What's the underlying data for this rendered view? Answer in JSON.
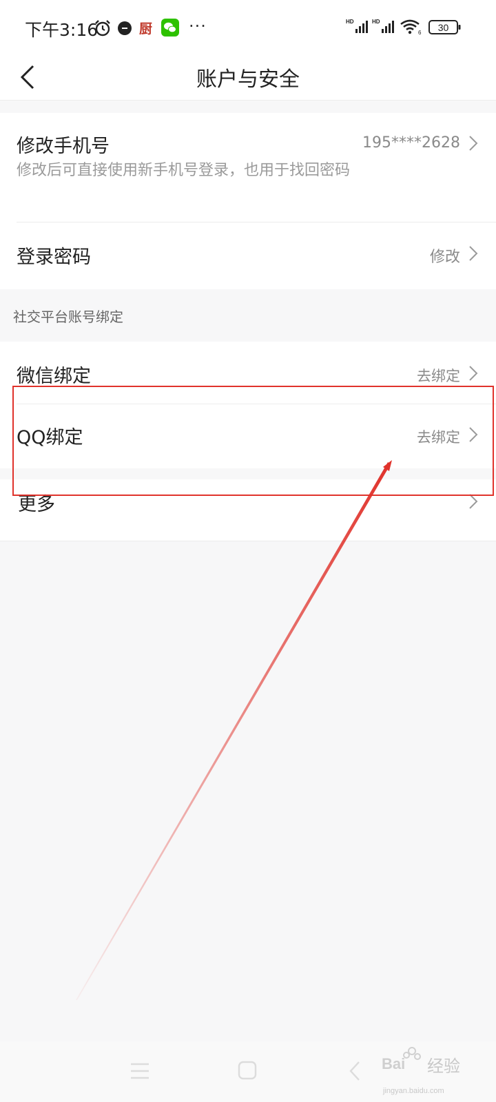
{
  "status_bar": {
    "time": "下午3:16",
    "chef_app_label": "厨",
    "more_dots": "···",
    "signal_label": "HD",
    "battery_level": "30"
  },
  "nav": {
    "title": "账户与安全"
  },
  "phone_row": {
    "title": "修改手机号",
    "subtitle": "修改后可直接使用新手机号登录，也用于找回密码",
    "value": "195****2628"
  },
  "password_row": {
    "title": "登录密码",
    "value": "修改"
  },
  "social_section": {
    "label": "社交平台账号绑定"
  },
  "wechat_row": {
    "title": "微信绑定",
    "value": "去绑定"
  },
  "qq_row": {
    "title": "QQ绑定",
    "value": "去绑定"
  },
  "more_row": {
    "title": "更多"
  },
  "watermark": {
    "brand": "Bai",
    "text": "经验",
    "url": "jingyan.baidu.com"
  },
  "colors": {
    "annotation_red": "#e0322b",
    "background": "#f7f7f8"
  }
}
